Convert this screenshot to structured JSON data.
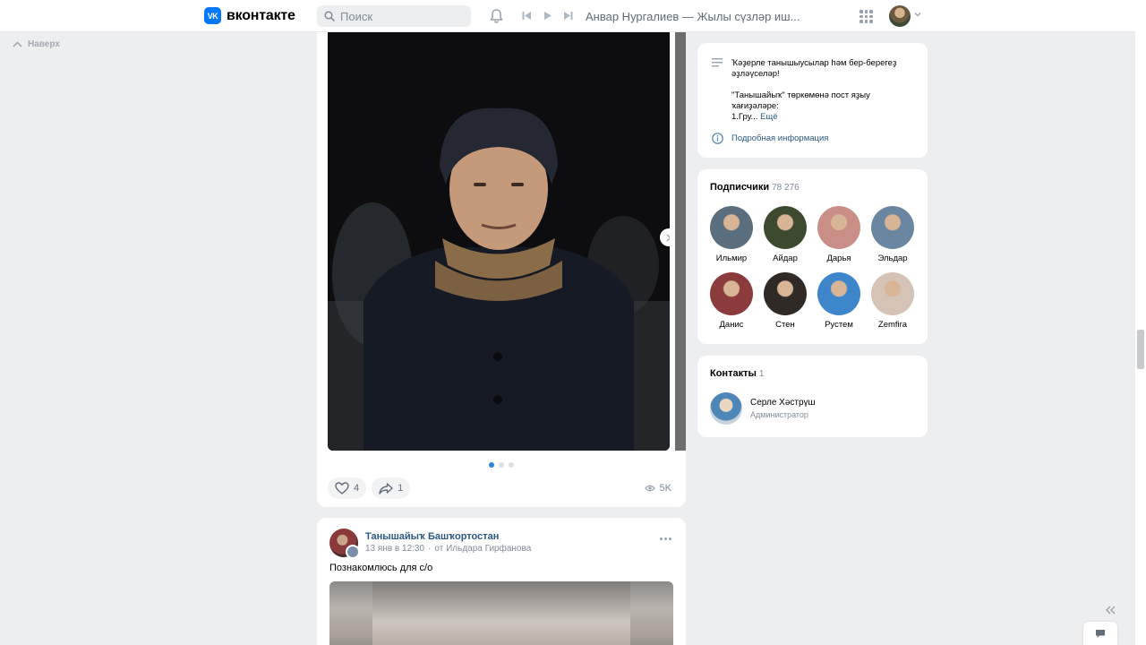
{
  "header": {
    "logo_text": "вконтакте",
    "logo_mark": "VK",
    "search_placeholder": "Поиск",
    "now_playing": "Анвар Нургалиев — Жылы сүзләр иш..."
  },
  "left_nav": {
    "back_to_top": "Наверх"
  },
  "post1": {
    "likes": "4",
    "shares": "1",
    "views": "5K",
    "gallery_pages": 3,
    "gallery_current": 1
  },
  "post2": {
    "author": "Танышайыҡ Башҡортостан",
    "time": "13 янв в 12:30",
    "from": "от Ильдара Гирфанова",
    "text": "Познакомлюсь для с/о"
  },
  "info_card": {
    "line1": "Ҡәҙерле танышыусылар һәм бер-берегеҙ",
    "line2": "әҙләүселәр!",
    "line3": "\"Танышайыҡ\" төркөмөнә пост яҙыу",
    "line4": "ҡағиҙәләре:",
    "line5": "1.Гру...",
    "more": "Ещё",
    "details_link": "Подробная информация"
  },
  "subscribers": {
    "title": "Подписчики",
    "count": "78 276",
    "items": [
      {
        "name": "Ильмир",
        "color": "#5a6e7d"
      },
      {
        "name": "Айдар",
        "color": "#3d4a2f"
      },
      {
        "name": "Дарья",
        "color": "#c98f86"
      },
      {
        "name": "Эльдар",
        "color": "#6b86a0"
      },
      {
        "name": "Данис",
        "color": "#8b3b3b"
      },
      {
        "name": "Стен",
        "color": "#2f2a26"
      },
      {
        "name": "Рустем",
        "color": "#3c86c9"
      },
      {
        "name": "Zemfira",
        "color": "#d4c3b6"
      }
    ]
  },
  "contacts": {
    "title": "Контакты",
    "count": "1",
    "name": "Серле Хәстрүш",
    "role": "Администратор"
  }
}
